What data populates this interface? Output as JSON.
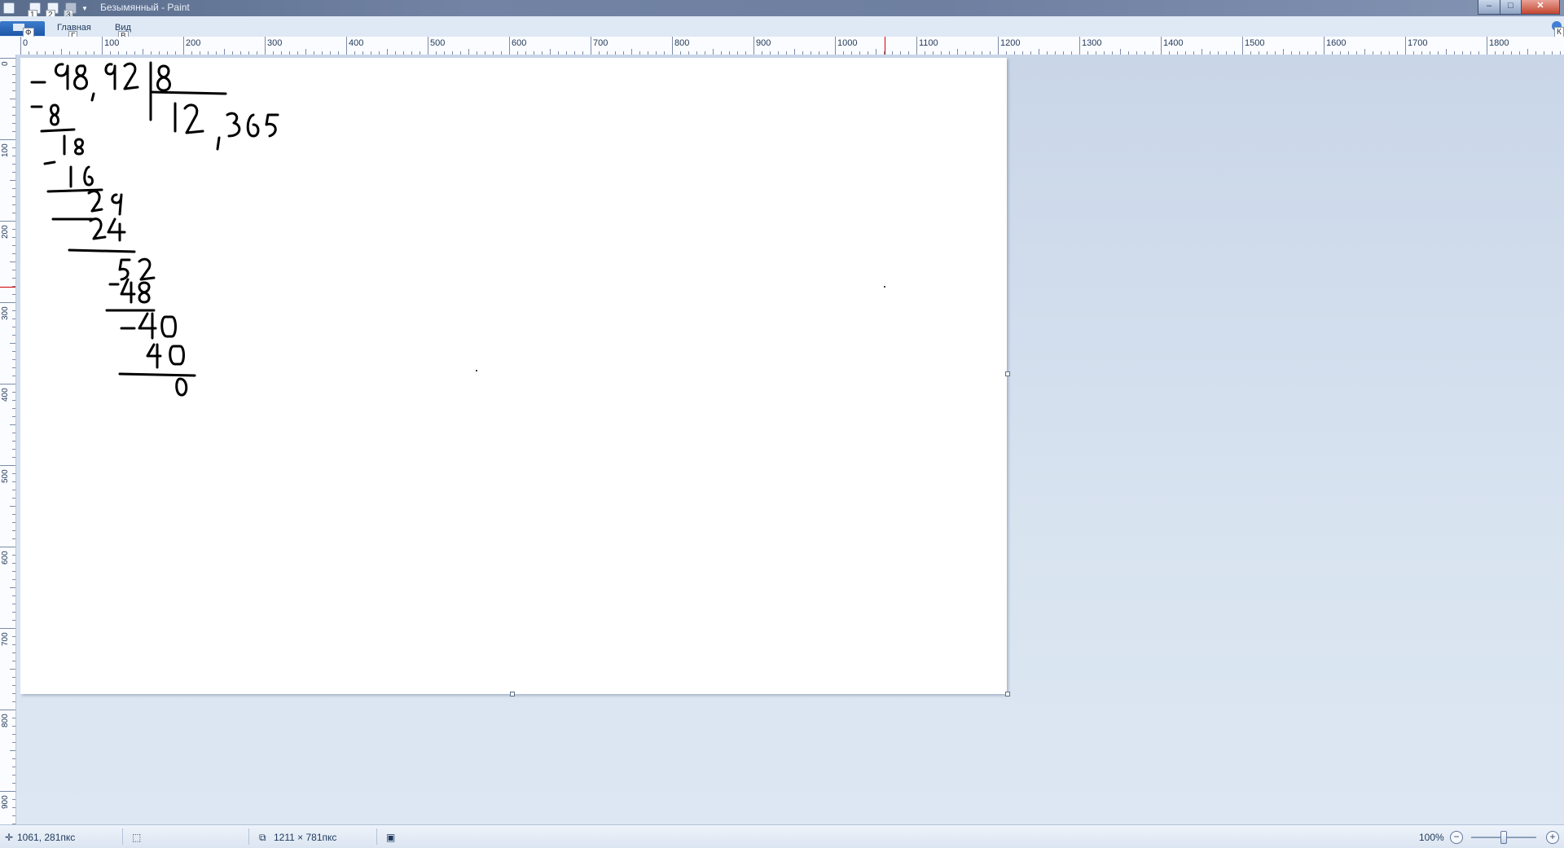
{
  "window": {
    "title": "Безымянный - Paint",
    "controls": {
      "minimize": "–",
      "maximize": "□",
      "close": "✕"
    }
  },
  "quick_access": {
    "keytips": [
      "1",
      "2",
      "3"
    ]
  },
  "ribbon": {
    "app_menu_keytip": "Ф",
    "tabs": [
      {
        "label": "Главная",
        "keytip": "Г"
      },
      {
        "label": "Вид",
        "keytip": "В"
      }
    ],
    "help_keytip": "К"
  },
  "ruler": {
    "horizontal_labels": [
      "0",
      "100",
      "200",
      "300",
      "400",
      "500",
      "600",
      "700",
      "800",
      "900",
      "1000",
      "1100",
      "1200",
      "1300",
      "1400",
      "1500",
      "1600",
      "1700",
      "1800"
    ],
    "vertical_labels": [
      "0",
      "100",
      "200",
      "300",
      "400",
      "500",
      "600",
      "700",
      "800",
      "900"
    ],
    "cursor_marker_color": "#d40000"
  },
  "canvas": {
    "background": "#ffffff",
    "drawing": {
      "dividend": "98,92",
      "divisor": "8",
      "quotient": "12,365",
      "steps": [
        "8",
        "18",
        "16",
        "29",
        "24",
        "52",
        "48",
        "40",
        "40",
        "0"
      ]
    }
  },
  "status": {
    "cursor_position": "1061, 281пкс",
    "selection_size": "",
    "image_size": "1211 × 781пкс",
    "file_size": "",
    "zoom": "100%",
    "zoom_out": "−",
    "zoom_in": "+"
  }
}
